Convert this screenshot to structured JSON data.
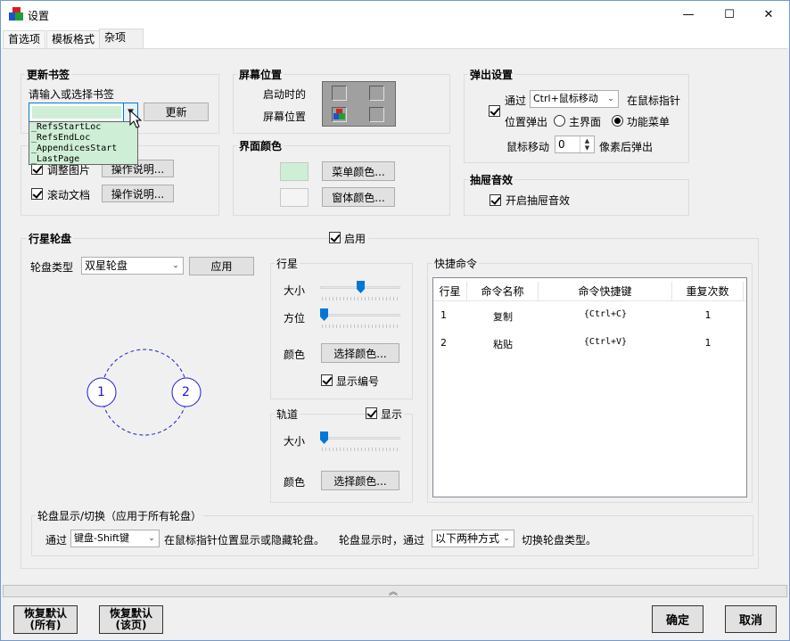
{
  "window": {
    "title": "设置",
    "minimize": "—",
    "maximize": "☐",
    "close": "✕"
  },
  "tabs": [
    {
      "label": "首选项"
    },
    {
      "label": "模板格式"
    },
    {
      "label": "杂项"
    }
  ],
  "bookmark": {
    "title": "更新书签",
    "prompt": "请输入或选择书签",
    "input_value": "",
    "update_button": "更新",
    "dropdown_items": [
      "_RefsStartLoc",
      "_RefsEndLoc",
      "_AppendicesStart",
      "_LastPage"
    ]
  },
  "misc": {
    "adjust_image": {
      "label": "调整图片",
      "checked": true,
      "help": "操作说明..."
    },
    "scroll_doc": {
      "label": "滚动文档",
      "checked": true,
      "help": "操作说明..."
    }
  },
  "screen_position": {
    "title": "屏幕位置",
    "on_start": "启动时的",
    "screen_pos": "屏幕位置"
  },
  "ui_colors": {
    "title": "界面颜色",
    "menu_color_button": "菜单颜色...",
    "window_color_button": "窗体颜色...",
    "menu_color": "#cfeed6",
    "window_color": "#f4f4f4"
  },
  "popup": {
    "title": "弹出设置",
    "via": "通过",
    "via_value": "Ctrl+鼠标移动",
    "at_cursor": "在鼠标指针",
    "pos_popup": "位置弹出",
    "option_main": "主界面",
    "option_menu": "功能菜单",
    "mouse_move": "鼠标移动",
    "pixels_value": "0",
    "pixels_after": "像素后弹出"
  },
  "drawer_sound": {
    "title": "抽屉音效",
    "enable_label": "开启抽屉音效",
    "checked": true
  },
  "star_wheel": {
    "title": "行星轮盘",
    "enable_label": "启用",
    "enabled": true,
    "type_label": "轮盘类型",
    "type_value": "双星轮盘",
    "apply_button": "应用",
    "node1": "1",
    "node2": "2"
  },
  "planet": {
    "title": "行星",
    "size_label": "大小",
    "size_value": 0.5,
    "direction_label": "方位",
    "direction_value": 0,
    "color_label": "颜色",
    "color_button": "选择颜色...",
    "show_number_label": "显示编号",
    "show_number": true
  },
  "orbit": {
    "title": "轨道",
    "show_label": "显示",
    "show": true,
    "size_label": "大小",
    "size_value": 0,
    "color_label": "颜色",
    "color_button": "选择颜色..."
  },
  "shortcuts": {
    "title": "快捷命令",
    "columns": [
      "行星",
      "命令名称",
      "命令快捷键",
      "重复次数"
    ],
    "rows": [
      {
        "planet": "1",
        "name": "复制",
        "key": "{Ctrl+C}",
        "repeat": "1"
      },
      {
        "planet": "2",
        "name": "粘贴",
        "key": "{Ctrl+V}",
        "repeat": "1"
      }
    ]
  },
  "wheel_toggle": {
    "title": "轮盘显示/切换（应用于所有轮盘）",
    "via": "通过",
    "key_value": "键盘-Shift键",
    "show_hide_text": "在鼠标指针位置显示或隐藏轮盘。",
    "when_shown": "轮盘显示时，通过",
    "switch_value": "以下两种方式",
    "switch_text": "切换轮盘类型。"
  },
  "footer": {
    "restore_all_line1": "恢复默认",
    "restore_all_line2": "(所有)",
    "restore_page_line1": "恢复默认",
    "restore_page_line2": "(该页)",
    "ok": "确定",
    "cancel": "取消",
    "collapse": "︽"
  }
}
